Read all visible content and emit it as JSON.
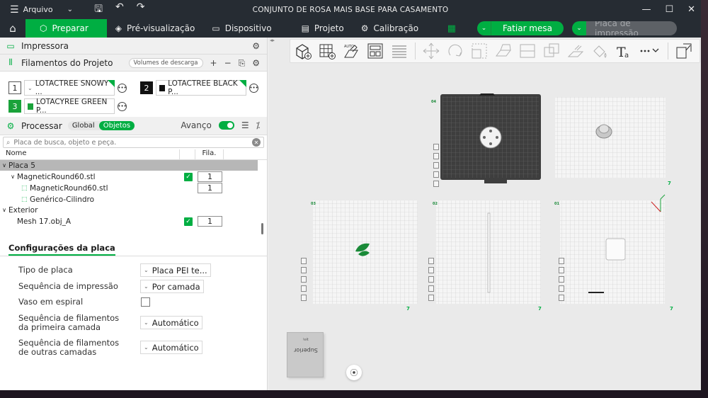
{
  "window": {
    "menu_label": "Arquivo",
    "title": "CONJUNTO DE ROSA MAIS BASE PARA CASAMENTO"
  },
  "nav": {
    "tabs": [
      {
        "label": "Preparar",
        "icon": "cube-icon",
        "active": true
      },
      {
        "label": "Pré-visualização",
        "icon": "layers-icon",
        "active": false
      },
      {
        "label": "Dispositivo",
        "icon": "monitor-icon",
        "active": false
      },
      {
        "label": "Projeto",
        "icon": "document-icon",
        "active": false
      },
      {
        "label": "Calibração",
        "icon": "gear-icon",
        "active": false
      }
    ],
    "slice_label": "Fatiar mesa",
    "print_label": "Placa de impressão"
  },
  "printer": {
    "label": "Impressora"
  },
  "filaments": {
    "label": "Filamentos do Projeto",
    "volumes_label": "Volumes de descarga",
    "items": [
      {
        "num": "1",
        "name": "LOTACTREE SNOWY ...",
        "color": "#ffffff"
      },
      {
        "num": "2",
        "name": "LOTACTREE BLACK P...",
        "color": "#111111"
      },
      {
        "num": "3",
        "name": "LOTACYREE GREEN P...",
        "color": "#1aa23a"
      }
    ]
  },
  "process": {
    "label": "Processar",
    "global_label": "Global",
    "objects_label": "Objetos",
    "advanced_label": "Avanço",
    "search_placeholder": "Placa de busca, objeto e peça."
  },
  "tree": {
    "col_name": "Nome",
    "col_fila": "Fila.",
    "plate": "Placa 5",
    "rows": [
      {
        "name": "MagneticRound60.stl",
        "qty": "1"
      },
      {
        "name": "MagneticRound60.stl",
        "qty": "1"
      },
      {
        "name": "Genérico-Cilindro"
      },
      {
        "name": "Exterior"
      },
      {
        "name": "Mesh 17.obj_A",
        "qty": "1"
      }
    ]
  },
  "plate_settings": {
    "tab": "Configurações da placa",
    "rows": [
      {
        "label": "Tipo de placa",
        "value": "Placa PEI te..."
      },
      {
        "label": "Sequência de impressão",
        "value": "Por camada"
      },
      {
        "label": "Vaso em espiral",
        "checked": false
      },
      {
        "label": "Sequência de filamentos da primeira camada",
        "value": "Automático"
      },
      {
        "label": "Sequência de filamentos de outras camadas",
        "value": "Automático"
      }
    ]
  },
  "viewport": {
    "plates": [
      {
        "tag": "04",
        "corner": "7"
      },
      {
        "tag": "03",
        "corner": "7"
      },
      {
        "tag": "02",
        "corner": "7"
      },
      {
        "tag": "01",
        "corner": "7"
      }
    ],
    "cube_face": "Superior",
    "cube_face2": "ʇɟǝן"
  },
  "colors": {
    "accent": "#00ae42",
    "titlebar": "#262c33"
  }
}
